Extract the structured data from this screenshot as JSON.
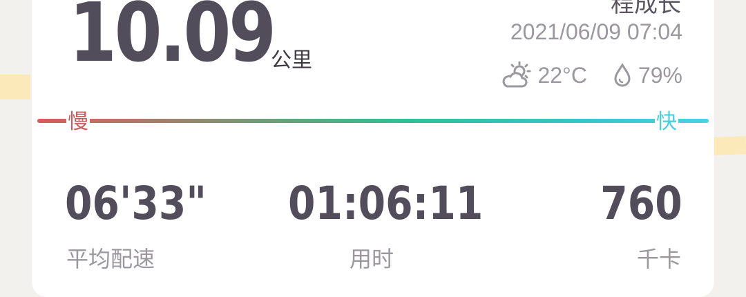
{
  "workout": {
    "distance": "10.09",
    "distance_unit": "公里",
    "title_partial": "程成长",
    "datetime": "2021/06/09 07:04",
    "weather": {
      "icon": "partly-cloudy-icon",
      "temperature": "22°C"
    },
    "humidity": {
      "icon": "droplet-icon",
      "value": "79%"
    }
  },
  "speed_legend": {
    "slow": "慢",
    "fast": "快",
    "slow_color": "#d0585a",
    "mid_color": "#2fc096",
    "fast_color": "#45cfdc"
  },
  "stats": {
    "pace": {
      "value": "06'33\"",
      "label": "平均配速"
    },
    "duration": {
      "value": "01:06:11",
      "label": "用时"
    },
    "calories": {
      "value": "760",
      "label": "千卡"
    }
  }
}
